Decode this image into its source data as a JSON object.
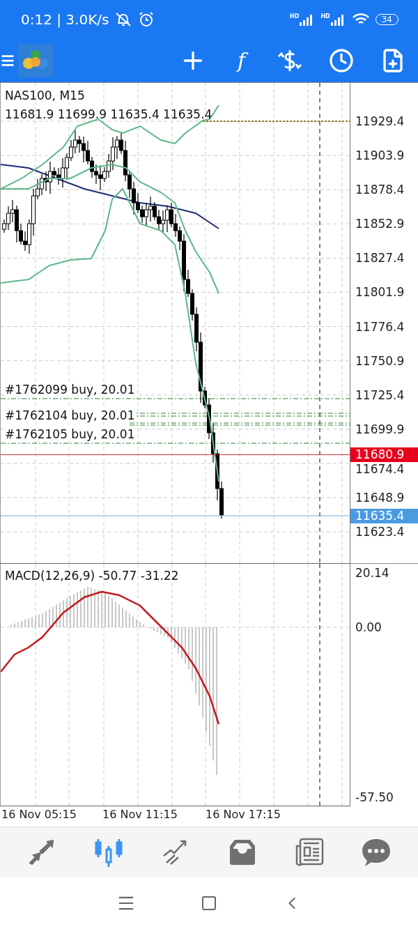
{
  "status_bar": {
    "time_speed": "0:12 | 3.0K/s",
    "signal_labels": [
      "HD",
      "HD"
    ],
    "battery": "34"
  },
  "toolbar": {
    "indicator_glyph": "f"
  },
  "chart": {
    "symbol": "NAS100, M15",
    "ohlc": "11681.9 11699.9 11635.4 11635.4",
    "orders": [
      {
        "label": "#1762099 buy, 20.01"
      },
      {
        "label": "#1762104 buy, 20.01"
      },
      {
        "label": "#1762105 buy, 20.01"
      }
    ],
    "price_axis": [
      "11929.4",
      "11903.9",
      "11878.4",
      "11852.9",
      "11827.4",
      "11801.9",
      "11776.4",
      "11750.9",
      "11725.4",
      "11699.9",
      "11674.4",
      "11648.9",
      "11623.4"
    ],
    "bid_tag": "11680.9",
    "last_tag": "11635.4"
  },
  "macd": {
    "label": "MACD(12,26,9) -50.77 -31.22",
    "axis": [
      "20.14",
      "0.00",
      "-57.50"
    ]
  },
  "time_axis": [
    "16 Nov 05:15",
    "16 Nov 11:15",
    "16 Nov 17:15"
  ],
  "bottom_nav": [
    {
      "kind": "quotes",
      "selected": false
    },
    {
      "kind": "chart",
      "selected": true
    },
    {
      "kind": "trade",
      "selected": false
    },
    {
      "kind": "history",
      "selected": false
    },
    {
      "kind": "news",
      "selected": false
    },
    {
      "kind": "messages",
      "selected": false
    }
  ]
}
